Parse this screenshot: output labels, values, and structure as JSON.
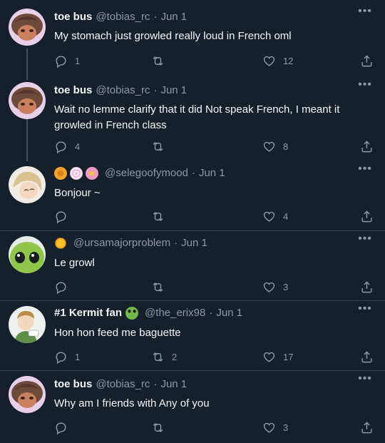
{
  "tweets": [
    {
      "name": "toe bus",
      "handle": "@tobias_rc",
      "date": "Jun 1",
      "text": "My stomach just growled really loud in French oml",
      "replies": "1",
      "retweets": "",
      "likes": "12"
    },
    {
      "name": "toe bus",
      "handle": "@tobias_rc",
      "date": "Jun 1",
      "text": "Wait no lemme clarify that it did Not speak French, I meant it growled in French class",
      "replies": "4",
      "retweets": "",
      "likes": "8"
    },
    {
      "name": "",
      "handle": "@selegoofymood",
      "date": "Jun 1",
      "text": "Bonjour ~",
      "replies": "",
      "retweets": "",
      "likes": "4"
    },
    {
      "name": "",
      "handle": "@ursamajorproblem",
      "date": "Jun 1",
      "text": "Le growl",
      "replies": "",
      "retweets": "",
      "likes": "3"
    },
    {
      "name": "#1 Kermit fan",
      "handle": "@the_erix98",
      "date": "Jun 1",
      "text": "Hon hon feed me baguette",
      "replies": "1",
      "retweets": "2",
      "likes": "17"
    },
    {
      "name": "toe bus",
      "handle": "@tobias_rc",
      "date": "Jun 1",
      "text": "Why am I friends with Any of you",
      "replies": "",
      "retweets": "",
      "likes": "3"
    }
  ],
  "ui": {
    "separator": "·",
    "more_glyph": "•••"
  },
  "icons": {
    "reply": "reply-icon",
    "retweet": "retweet-icon",
    "like": "heart-icon",
    "share": "share-icon",
    "more": "more-icon"
  },
  "colors": {
    "background": "#15202b",
    "text_primary": "#f7f9f9",
    "text_secondary": "#8b98a5",
    "thread_line": "#3d5466",
    "divider": "#38444d"
  }
}
